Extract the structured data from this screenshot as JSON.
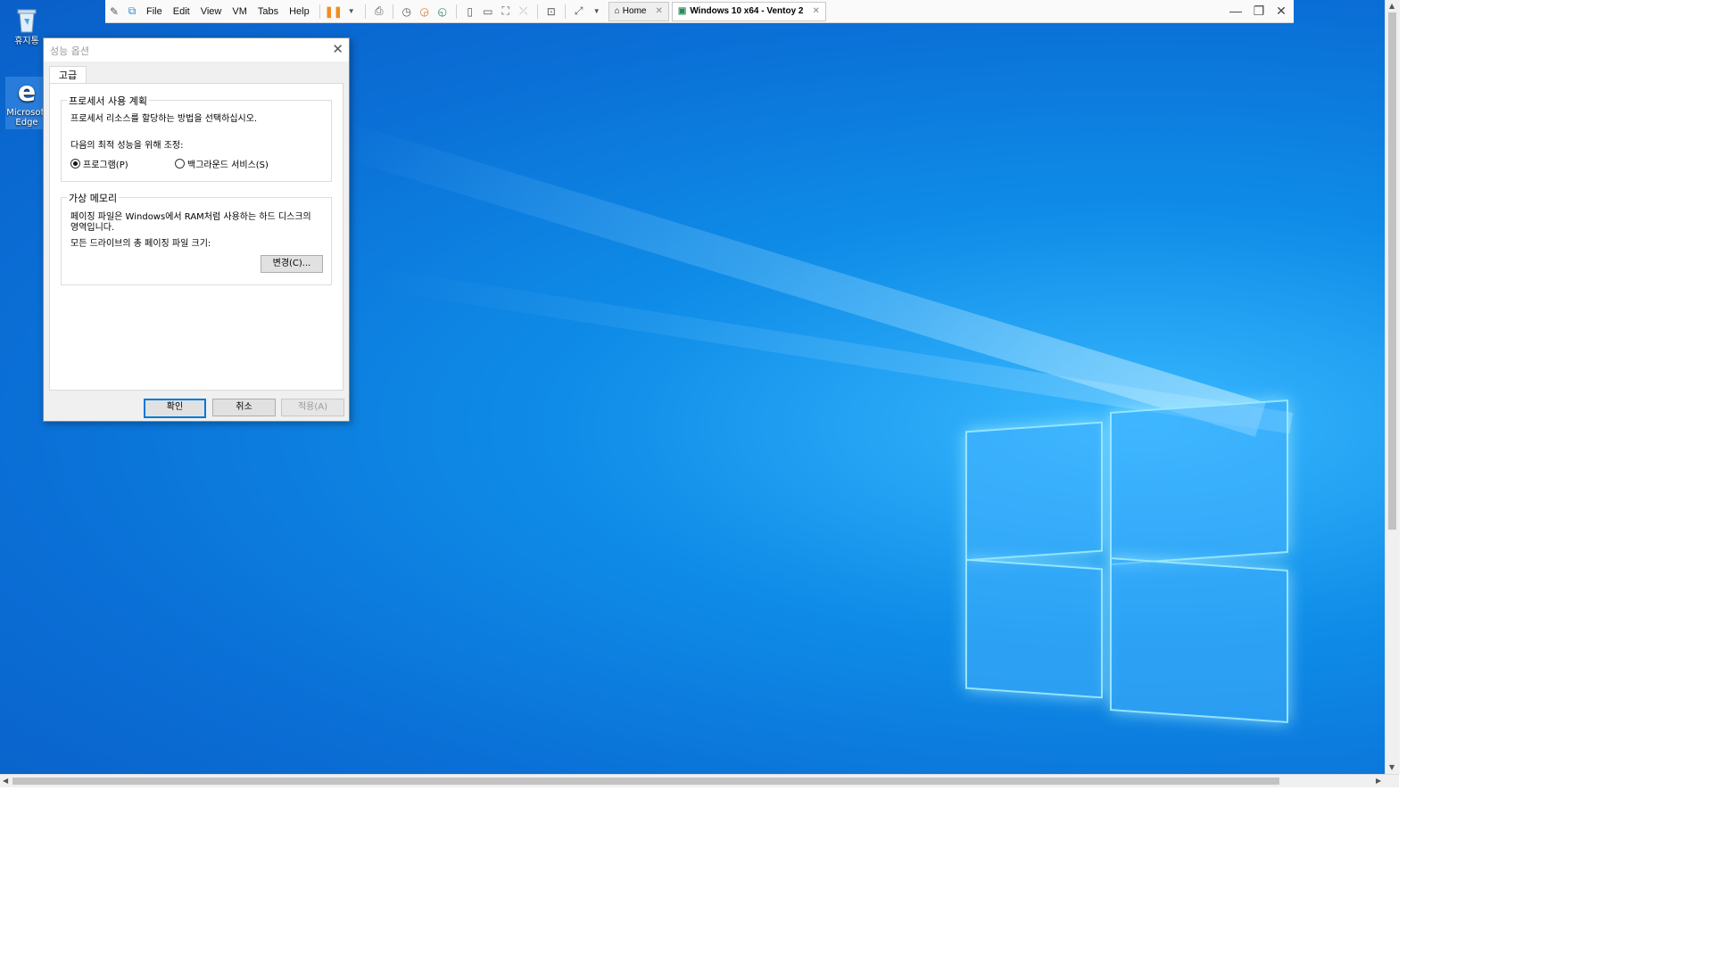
{
  "desktop": {
    "icons": [
      {
        "label": "휴지통"
      },
      {
        "label": "Microsoft Edge"
      }
    ]
  },
  "vmware": {
    "menus": [
      "File",
      "Edit",
      "View",
      "VM",
      "Tabs",
      "Help"
    ],
    "tabs": [
      {
        "label": "Home",
        "active": false
      },
      {
        "label": "Windows 10 x64 - Ventoy 2",
        "active": true
      }
    ]
  },
  "dialog": {
    "title": "성능 옵션",
    "tab_label": "고급",
    "processor_group": {
      "title": "프로세서 사용 계획",
      "description": "프로세서 리소스를 할당하는 방법을 선택하십시오.",
      "adjust_label": "다음의 최적 성능을 위해 조정:",
      "options": [
        {
          "label": "프로그램(P)",
          "selected": true
        },
        {
          "label": "백그라운드 서비스(S)",
          "selected": false
        }
      ]
    },
    "virtual_memory_group": {
      "title": "가상 메모리",
      "description_line1": "페이징 파일은 Windows에서 RAM처럼 사용하는 하드 디스크의",
      "description_line2": "영역입니다.",
      "total_label": "모든 드라이브의 총 페이징 파일 크기:",
      "change_button": "변경(C)..."
    },
    "buttons": {
      "ok": "확인",
      "cancel": "취소",
      "apply": "적용(A)"
    }
  },
  "colors": {
    "desktop_blue": "#0a6fd6",
    "focus_border": "#0078d7",
    "pause_orange": "#f28c1e"
  }
}
